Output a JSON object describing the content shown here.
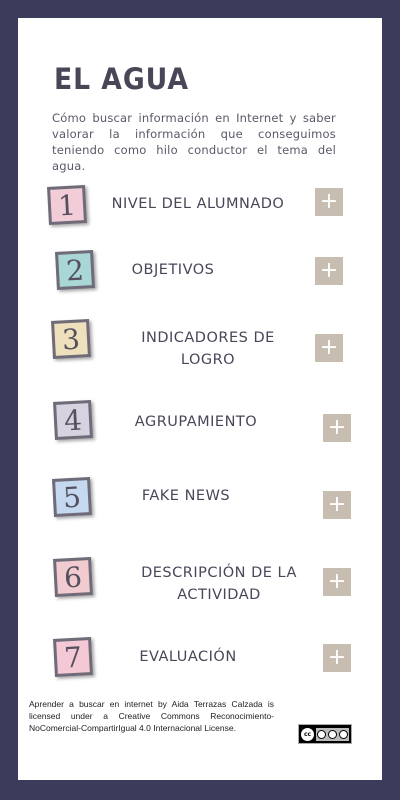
{
  "title": "EL AGUA",
  "intro": "Cómo buscar información en Internet y saber valorar la información que conseguimos teniendo como hilo conductor el tema del agua.",
  "plus_symbol": "+",
  "items": [
    {
      "number": "1",
      "label": "NIVEL DEL ALUMNADO",
      "color": "#f2cdd8"
    },
    {
      "number": "2",
      "label": "OBJETIVOS",
      "color": "#a8d7d6"
    },
    {
      "number": "3",
      "label": "INDICADORES DE LOGRO",
      "color": "#efe0bd"
    },
    {
      "number": "4",
      "label": "AGRUPAMIENTO",
      "color": "#d6d2df"
    },
    {
      "number": "5",
      "label": "FAKE NEWS",
      "color": "#c4d8f0"
    },
    {
      "number": "6",
      "label": "DESCRIPCIÓN DE LA ACTIVIDAD",
      "color": "#f2cbd0"
    },
    {
      "number": "7",
      "label": "EVALUACIÓN",
      "color": "#f4c8d4"
    }
  ],
  "license": {
    "text": "Aprender a buscar en internet by Aida Terrazas Calzada is licensed under a Creative Commons Reconocimiento-NoComercial-CompartirIgual 4.0 Internacional License.",
    "badge_text": "cc",
    "badge_icon": "creative-commons-by-nc-sa-icon"
  },
  "colors": {
    "background": "#3b3b5c",
    "card": "#ffffff",
    "button": "#c8bdb1",
    "text": "#4a4658"
  }
}
